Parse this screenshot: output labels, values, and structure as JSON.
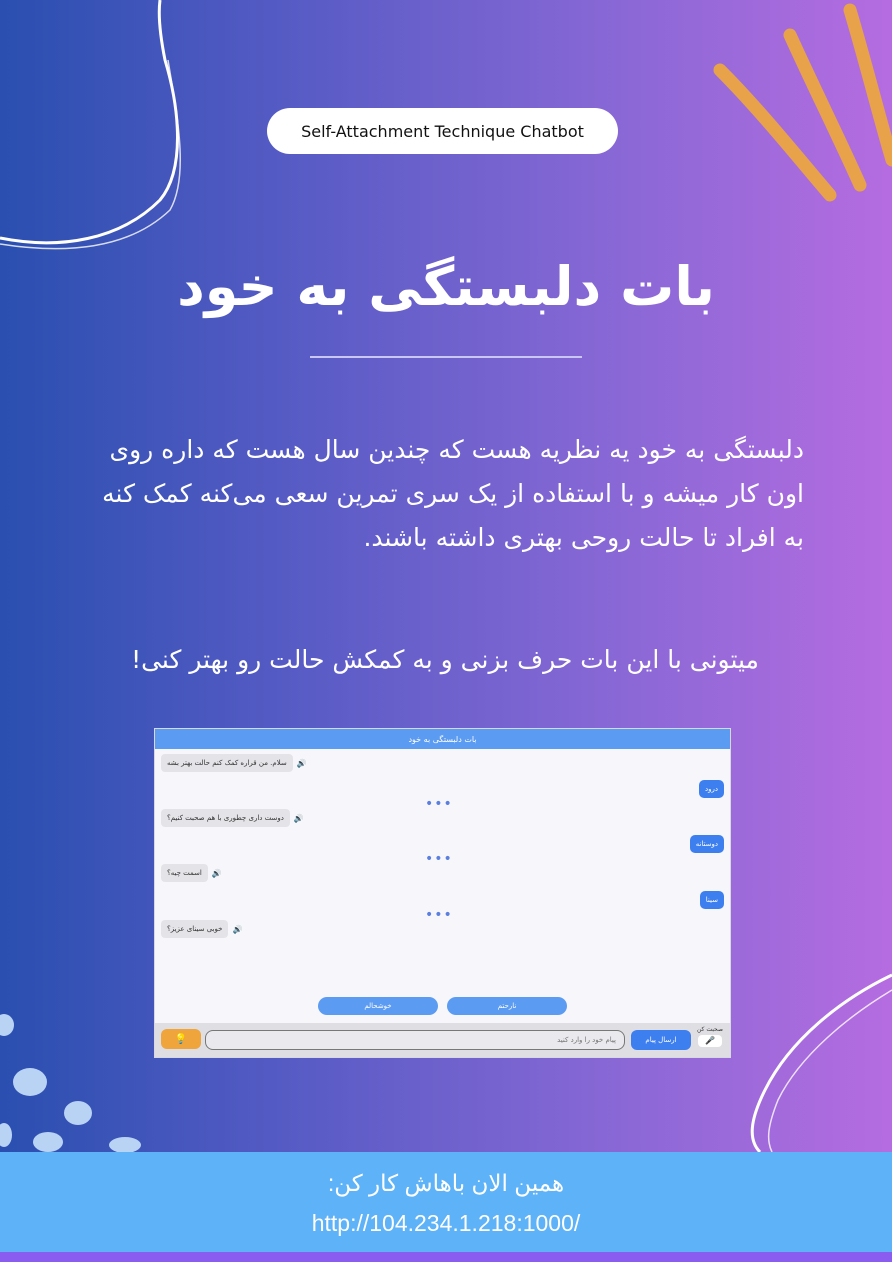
{
  "badge": "Self-Attachment Technique Chatbot",
  "title": "بات دلبستگی به خود",
  "description": "دلبستگی به خود یه نظریه هست که چندین سال هست که داره روی اون کار میشه و با استفاده از یک سری تمرین سعی می‌کنه کمک کنه به افراد تا حالت روحی بهتری داشته باشند.",
  "call_to_action": "میتونی با این بات حرف بزنی و به کمکش حالت رو بهتر کنی!",
  "chat_preview": {
    "header": "بات دلبستگی به خود",
    "bot_messages": [
      "سلام. من قراره کمک کنم حالت بهتر بشه",
      "دوست داری چطوری با هم صحبت کنیم؟",
      "اسمت چیه؟",
      "خوبی سینای عزیز؟"
    ],
    "user_messages": [
      "درود",
      "دوستانه",
      "سینا"
    ],
    "typing_indicator": "•••",
    "quick_replies": [
      "نارحتم",
      "خوشحالم"
    ],
    "input_placeholder": "پیام خود را وارد کنید",
    "send_label": "ارسال پیام",
    "voice_label": "صحبت کن",
    "icons": [
      "speaker-icon",
      "lightbulb-icon",
      "microphone-icon"
    ]
  },
  "footer": {
    "line1": "همین الان باهاش کار کن:",
    "url": "http://104.234.1.218:1000/"
  },
  "colors": {
    "gradient_start": "#2a4fb0",
    "gradient_end": "#b56ce0",
    "footer_bg": "#5eb2f8",
    "accent_orange": "#e8a24a"
  }
}
